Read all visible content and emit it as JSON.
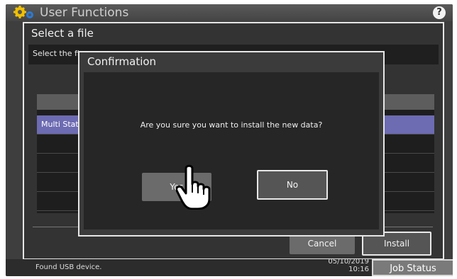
{
  "app": {
    "title": "User Functions",
    "help_label": "?"
  },
  "dialog": {
    "title": "Select a file",
    "instruction": "Select the fi",
    "list": {
      "rows": [
        "Multi Stat",
        "",
        "",
        "",
        ""
      ]
    },
    "cancel_label": "Cancel",
    "install_label": "Install"
  },
  "confirmation": {
    "title": "Confirmation",
    "message": "Are you sure you want to install the new data?",
    "yes_label": "Yes",
    "no_label": "No"
  },
  "status": {
    "message": "Found USB device.",
    "date": "05/10/2019",
    "time": "10:16",
    "job_status_label": "Job Status"
  },
  "colors": {
    "selected_row": "#6d6bb2",
    "background": "#3e3e3e"
  },
  "icons": {
    "app_icon": "gears-icon",
    "pointer": "hand-pointer-icon"
  }
}
